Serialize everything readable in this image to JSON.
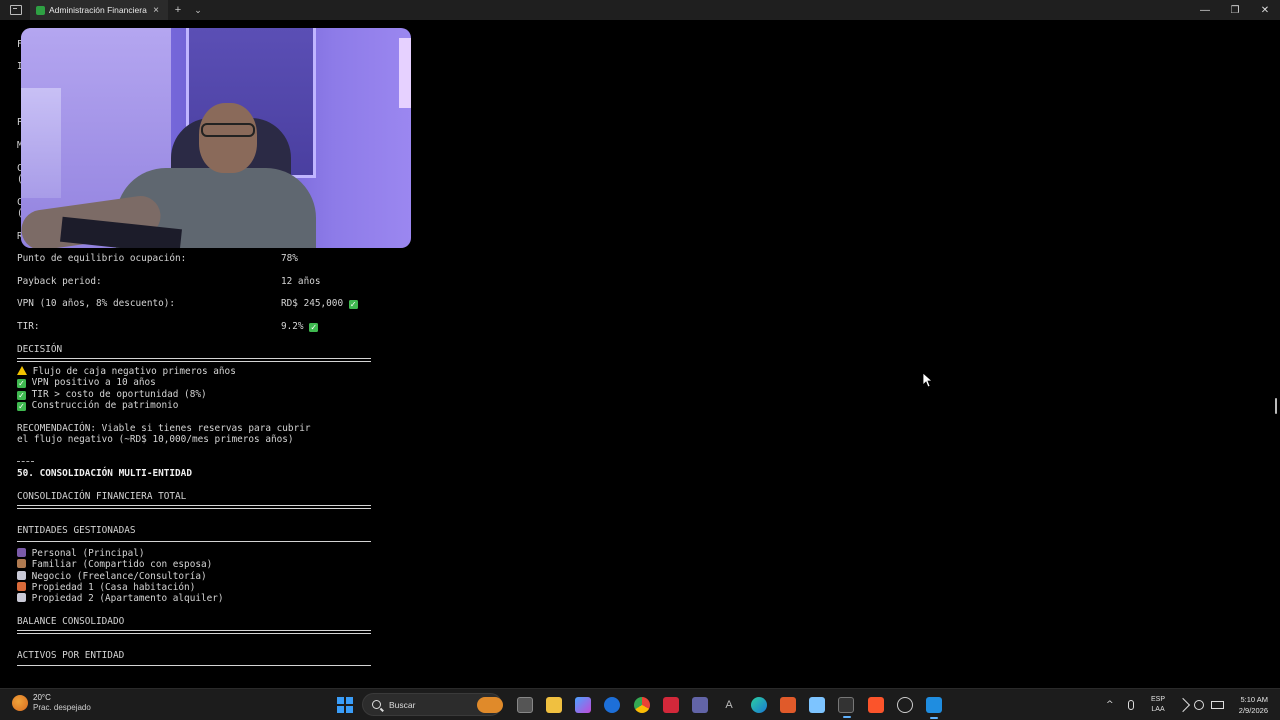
{
  "window": {
    "tab_title": "Administración Financiera",
    "tab_close": "×",
    "new_tab": "+",
    "tab_menu": "⌄",
    "minimize": "—",
    "maximize": "❐",
    "close": "✕"
  },
  "terminal": {
    "rows": [
      {
        "label": "Punto de equilibrio ocupación:",
        "value": "78%"
      },
      {
        "label": "Payback period:",
        "value": "12 años"
      },
      {
        "label": "VPN (10 años, 8% descuento):",
        "value": "RD$ 245,000",
        "check": true
      },
      {
        "label": "TIR:",
        "value": "9.2%",
        "check": true
      }
    ],
    "decision_heading": "DECISIÓN",
    "decision_items": [
      {
        "icon": "warning",
        "text": "Flujo de caja negativo primeros años"
      },
      {
        "icon": "check",
        "text": "VPN positivo a 10 años"
      },
      {
        "icon": "check",
        "text": "TIR > costo de oportunidad (8%)"
      },
      {
        "icon": "check",
        "text": "Construcción de patrimonio"
      }
    ],
    "recommendation_line1": "RECOMENDACIÓN: Viable si tienes reservas para cubrir",
    "recommendation_line2": "el flujo negativo (~RD$ 10,000/mes primeros años)",
    "section_title": "50. CONSOLIDACIÓN MULTI-ENTIDAD",
    "consolidation_heading": "CONSOLIDACIÓN FINANCIERA TOTAL",
    "entities_heading": "ENTIDADES GESTIONADAS",
    "entities": [
      {
        "icon": "person",
        "text": "Personal (Principal)"
      },
      {
        "icon": "family",
        "text": "Familiar (Compartido con esposa)"
      },
      {
        "icon": "building",
        "text": "Negocio (Freelance/Consultoría)"
      },
      {
        "icon": "house",
        "text": "Propiedad 1 (Casa habitación)"
      },
      {
        "icon": "building",
        "text": "Propiedad 2 (Apartamento alquiler)"
      }
    ],
    "balance_heading": "BALANCE CONSOLIDADO",
    "assets_heading": "ACTIVOS POR ENTIDAD",
    "hidden_left_chars": [
      "F",
      "I",
      "P",
      "M",
      "C",
      "(",
      "C",
      "(",
      "R"
    ]
  },
  "taskbar": {
    "temperature": "20°C",
    "weather": "Prac. despejado",
    "search_label": "Buscar",
    "lang_top": "ESP",
    "lang_bottom": "LAA",
    "time": "5:10 AM",
    "date": "2/9/2026"
  }
}
